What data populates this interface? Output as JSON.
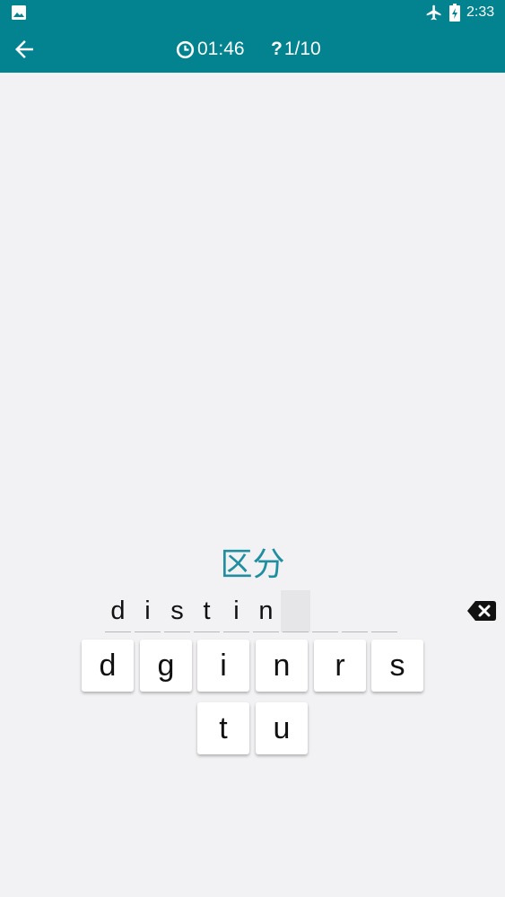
{
  "status_bar": {
    "time": "2:33"
  },
  "header": {
    "timer": "01:46",
    "progress": "1/10"
  },
  "question": {
    "prompt": "区分"
  },
  "answer": {
    "slots": [
      "d",
      "i",
      "s",
      "t",
      "i",
      "n",
      "",
      "",
      "",
      ""
    ],
    "active_index": 6
  },
  "keyboard": {
    "keys": [
      "d",
      "g",
      "i",
      "n",
      "r",
      "s",
      "t",
      "u"
    ]
  },
  "colors": {
    "primary": "#02838f",
    "prompt": "#1e8ea0",
    "background": "#f2f1f3"
  }
}
